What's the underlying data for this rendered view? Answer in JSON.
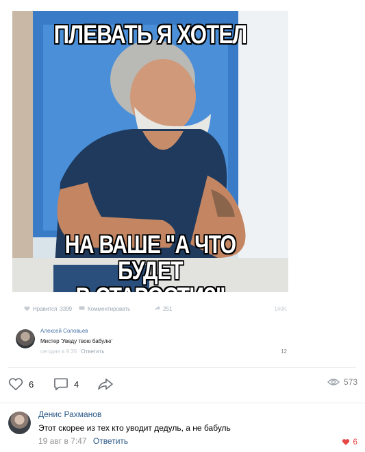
{
  "meme": {
    "top_caption": "ПЛЕВАТЬ Я ХОТЕЛ",
    "bottom_caption_line1": "НА ВАШЕ \"А ЧТО БУДЕТ",
    "bottom_caption_line2": "В СТАРОСТИ?\""
  },
  "inner_post": {
    "like_label": "Нравится",
    "like_count": "3399",
    "comment_label": "Комментировать",
    "share_count": "251",
    "views": "140K",
    "comment": {
      "author": "Алексей Соловьев",
      "text": "Мистер 'Уведу твою бабулю'",
      "date": "сегодня в 9:35",
      "reply": "Ответить",
      "likes": "12"
    }
  },
  "post_actions": {
    "likes": "6",
    "comments": "4",
    "views": "573"
  },
  "comment": {
    "author": "Денис Рахманов",
    "text": "Этот скорее из тех кто уводит дедуль, а не бабуль",
    "date": "19 авг в 7:47",
    "reply": "Ответить",
    "likes": "6"
  },
  "colors": {
    "link": "#2a5885",
    "like_active": "#e64646",
    "muted": "#939393",
    "divider": "#e7e8ec"
  }
}
